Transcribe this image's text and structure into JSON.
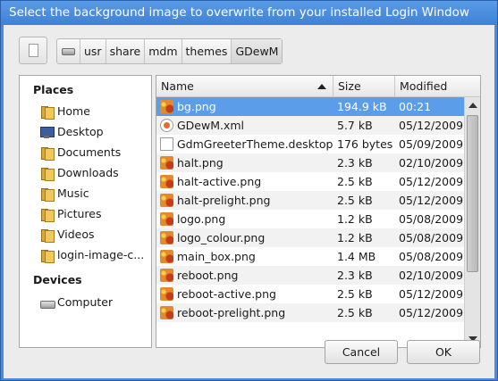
{
  "window": {
    "title": "Select the background image to overwrite from your installed Login Window"
  },
  "pathbar": {
    "segments": [
      "usr",
      "share",
      "mdm",
      "themes",
      "GDewM"
    ]
  },
  "places": {
    "header": "Places",
    "items": [
      {
        "label": "Home",
        "icon": "home-folder-icon"
      },
      {
        "label": "Desktop",
        "icon": "desktop-icon"
      },
      {
        "label": "Documents",
        "icon": "folder-icon"
      },
      {
        "label": "Downloads",
        "icon": "folder-icon"
      },
      {
        "label": "Music",
        "icon": "folder-icon"
      },
      {
        "label": "Pictures",
        "icon": "folder-icon"
      },
      {
        "label": "Videos",
        "icon": "folder-icon"
      },
      {
        "label": "login-image-c...",
        "icon": "folder-icon"
      }
    ],
    "devices_header": "Devices",
    "devices": [
      {
        "label": "Computer",
        "icon": "computer-icon"
      }
    ]
  },
  "filelist": {
    "columns": {
      "name": "Name",
      "size": "Size",
      "modified": "Modified"
    },
    "sort": "name-ascending",
    "files": [
      {
        "name": "bg.png",
        "size": "194.9 kB",
        "modified": "00:21",
        "icon": "image-file-icon"
      },
      {
        "name": "GDewM.xml",
        "size": "5.7 kB",
        "modified": "05/12/2009",
        "icon": "xml-file-icon"
      },
      {
        "name": "GdmGreeterTheme.desktop",
        "size": "176 bytes",
        "modified": "05/09/2009",
        "icon": "text-file-icon"
      },
      {
        "name": "halt.png",
        "size": "2.3 kB",
        "modified": "02/10/2009",
        "icon": "image-file-icon"
      },
      {
        "name": "halt-active.png",
        "size": "2.5 kB",
        "modified": "05/12/2009",
        "icon": "image-file-icon"
      },
      {
        "name": "halt-prelight.png",
        "size": "2.5 kB",
        "modified": "05/12/2009",
        "icon": "image-file-icon"
      },
      {
        "name": "logo.png",
        "size": "1.2 kB",
        "modified": "05/08/2009",
        "icon": "image-file-icon"
      },
      {
        "name": "logo_colour.png",
        "size": "1.2 kB",
        "modified": "05/08/2009",
        "icon": "image-file-icon"
      },
      {
        "name": "main_box.png",
        "size": "1.4 MB",
        "modified": "05/08/2009",
        "icon": "image-file-icon"
      },
      {
        "name": "reboot.png",
        "size": "2.3 kB",
        "modified": "02/10/2009",
        "icon": "image-file-icon"
      },
      {
        "name": "reboot-active.png",
        "size": "2.5 kB",
        "modified": "05/12/2009",
        "icon": "image-file-icon"
      },
      {
        "name": "reboot-prelight.png",
        "size": "2.5 kB",
        "modified": "05/12/2009",
        "icon": "image-file-icon"
      }
    ]
  },
  "buttons": {
    "cancel": "Cancel",
    "ok": "OK"
  },
  "colors": {
    "titlebar": "#4a8ad8",
    "selection": "#5b9de8"
  }
}
